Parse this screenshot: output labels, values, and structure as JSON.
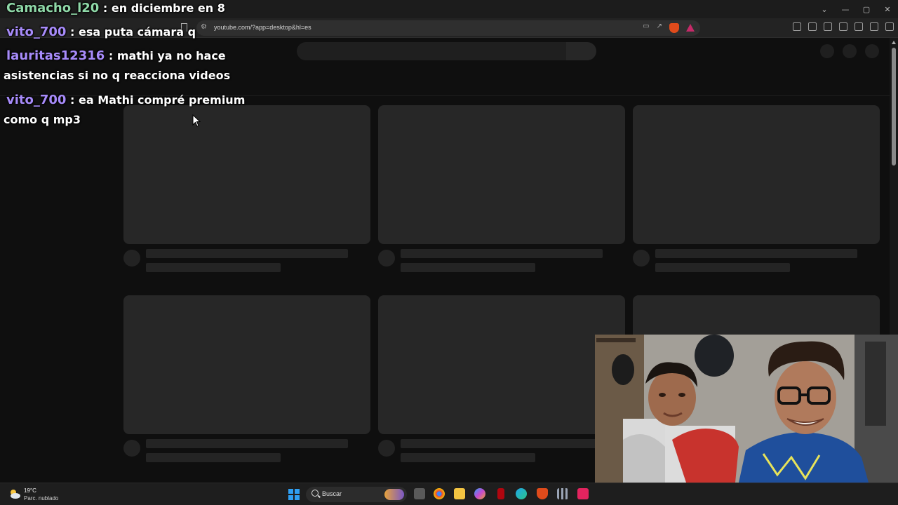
{
  "browser": {
    "url": "youtube.com/?app=desktop&hl=es",
    "window_controls": [
      "⌄",
      "—",
      "▢",
      "✕"
    ]
  },
  "chat": {
    "messages": [
      {
        "user": "Camacho_l20",
        "user_color": "#8fd9a8",
        "text": ": en diciembre en 8",
        "continuation": ""
      },
      {
        "user": "vito_700",
        "user_color": "#a78bfa",
        "text": ": esa puta cámara q",
        "continuation": ""
      },
      {
        "user": "lauritas12316",
        "user_color": "#a78bfa",
        "text": ": mathi ya no hace",
        "continuation": "asistencias si no q reacciona videos"
      },
      {
        "user": "vito_700",
        "user_color": "#a78bfa",
        "text": ": ea Mathi compré premium",
        "continuation": "como q mp3"
      }
    ]
  },
  "taskbar": {
    "weather_temp": "19°C",
    "weather_desc": "Parc. nublado",
    "search_placeholder": "Buscar"
  },
  "colors": {
    "page_bg": "#0f0f0f",
    "skeleton": "#272727",
    "start_blue": "#2f9ff2",
    "brave_orange": "#e04b1b"
  },
  "icons": [
    "bookmark-icon",
    "site-info-icon",
    "cast-icon",
    "share-icon",
    "brave-shield-icon",
    "brave-rewards-icon",
    "extensions-icon",
    "sidebar-icon",
    "wallet-icon",
    "leo-icon",
    "vpn-icon",
    "menu-icon",
    "windows-start-icon",
    "search-icon",
    "chrome-icon",
    "file-explorer-icon",
    "edge-icon",
    "brave-icon",
    "tiktok-icon"
  ]
}
